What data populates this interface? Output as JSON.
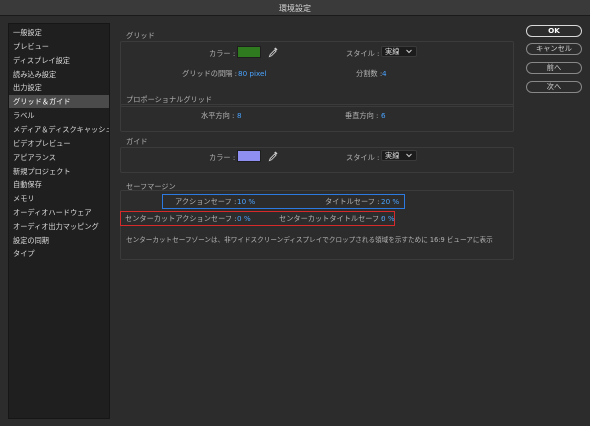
{
  "window": {
    "title": "環境設定"
  },
  "sidebar": {
    "items": [
      {
        "label": "一般設定"
      },
      {
        "label": "プレビュー"
      },
      {
        "label": "ディスプレイ設定"
      },
      {
        "label": "読み込み設定"
      },
      {
        "label": "出力設定"
      },
      {
        "label": "グリッド＆ガイド",
        "selected": true
      },
      {
        "label": "ラベル"
      },
      {
        "label": "メディア＆ディスクキャッシュ"
      },
      {
        "label": "ビデオプレビュー"
      },
      {
        "label": "アピアランス"
      },
      {
        "label": "新規プロジェクト"
      },
      {
        "label": "自動保存"
      },
      {
        "label": "メモリ"
      },
      {
        "label": "オーディオハードウェア"
      },
      {
        "label": "オーディオ出力マッピング"
      },
      {
        "label": "設定の同期"
      },
      {
        "label": "タイプ"
      }
    ]
  },
  "grid": {
    "title": "グリッド",
    "color_label": "カラー :",
    "color": "#2f7a1f",
    "style_label": "スタイル :",
    "style_value": "実線",
    "spacing_label": "グリッドの間隔 :",
    "spacing_value": "80 pixel",
    "subdiv_label": "分割数 :",
    "subdiv_value": "4"
  },
  "proportional": {
    "title": "プロポーショナルグリッド",
    "h_label": "水平方向 :",
    "h_value": "8",
    "v_label": "垂直方向 :",
    "v_value": "6"
  },
  "guide": {
    "title": "ガイド",
    "color_label": "カラー :",
    "color": "#8f8ff2",
    "style_label": "スタイル :",
    "style_value": "実線"
  },
  "safe": {
    "title": "セーフマージン",
    "action_label": "アクションセーフ :",
    "action_value": "10 %",
    "title_label": "タイトルセーフ :",
    "title_value": "20 %",
    "cc_action_label": "センターカットアクションセーフ :",
    "cc_action_value": "0 %",
    "cc_title_label": "センターカットタイトルセーフ :",
    "cc_title_value": "0 %",
    "note": "センターカットセーフゾーンは、非ワイドスクリーンディスプレイでクロップされる領域を示すために 16:9 ビューアに表示"
  },
  "buttons": {
    "ok": "OK",
    "cancel": "キャンセル",
    "prev": "前へ",
    "next": "次へ"
  },
  "colors": {
    "highlight_blue": "#2c7ae0",
    "highlight_red": "#d62a2a",
    "value_blue": "#4aa3ff"
  }
}
